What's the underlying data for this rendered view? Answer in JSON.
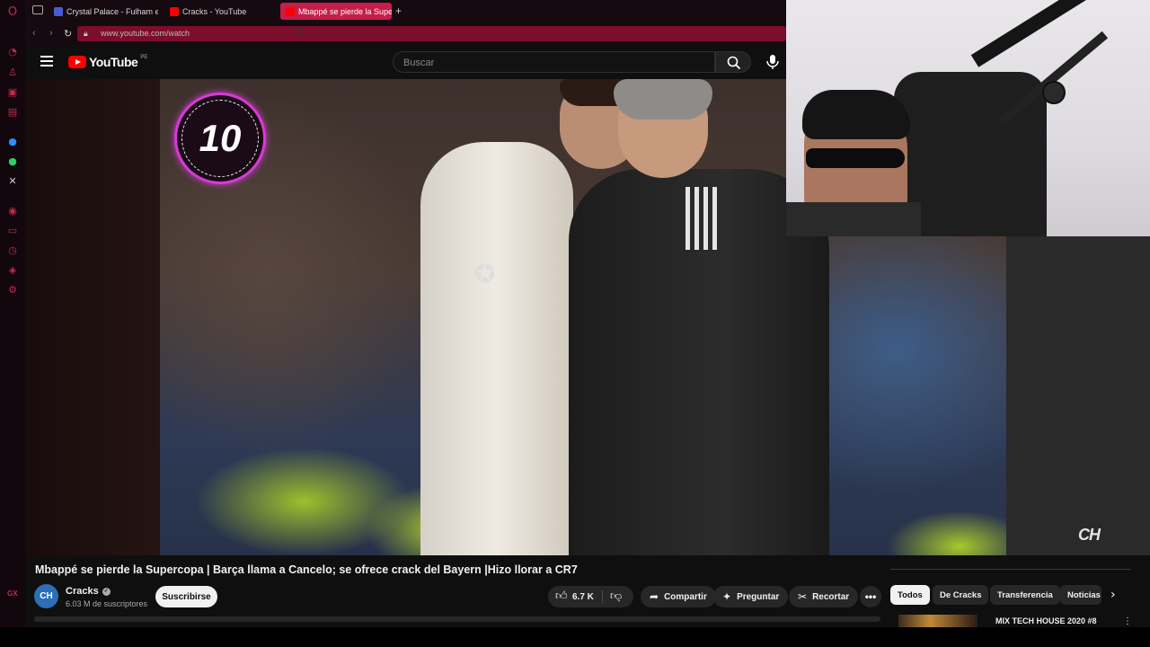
{
  "browser": {
    "tabs": [
      {
        "label": "Crystal Palace - Fulham en",
        "color": "#4a5bd4"
      },
      {
        "label": "Cracks - YouTube",
        "color": "#ff0000"
      },
      {
        "label": "Mbappé se pierde la Supe",
        "color": "#ff0000",
        "active": true
      }
    ],
    "url": "www.youtube.com/watch",
    "new_tab": "+"
  },
  "sidebar": {
    "icons": [
      "opera-icon",
      "speed-dial-icon",
      "bag-icon",
      "music-icon",
      "news-icon",
      "messenger-icon",
      "whatsapp-icon",
      "x-icon",
      "player-icon",
      "wallet-icon",
      "history-icon",
      "extensions-icon",
      "settings-icon"
    ],
    "gx": "GX"
  },
  "youtube": {
    "logo_text": "YouTube",
    "country_code": "PE",
    "search_placeholder": "Buscar"
  },
  "video": {
    "badge_number": "10",
    "watermark": "CH",
    "title": "Mbappé se pierde la Supercopa | Barça llama a Cancelo; se ofrece crack del Bayern |Hizo llorar a CR7"
  },
  "channel": {
    "avatar_text": "CH",
    "name": "Cracks",
    "subscribers": "6.03 M de suscriptores",
    "subscribe_label": "Suscribirse"
  },
  "actions": {
    "likes": "6.7 K",
    "share": "Compartir",
    "ask": "Preguntar",
    "clip": "Recortar",
    "more": "•••"
  },
  "chips": [
    "Todos",
    "De Cracks",
    "Transferencia",
    "Noticias"
  ],
  "suggestion": {
    "title": "MIX TECH HOUSE 2020 #8"
  }
}
